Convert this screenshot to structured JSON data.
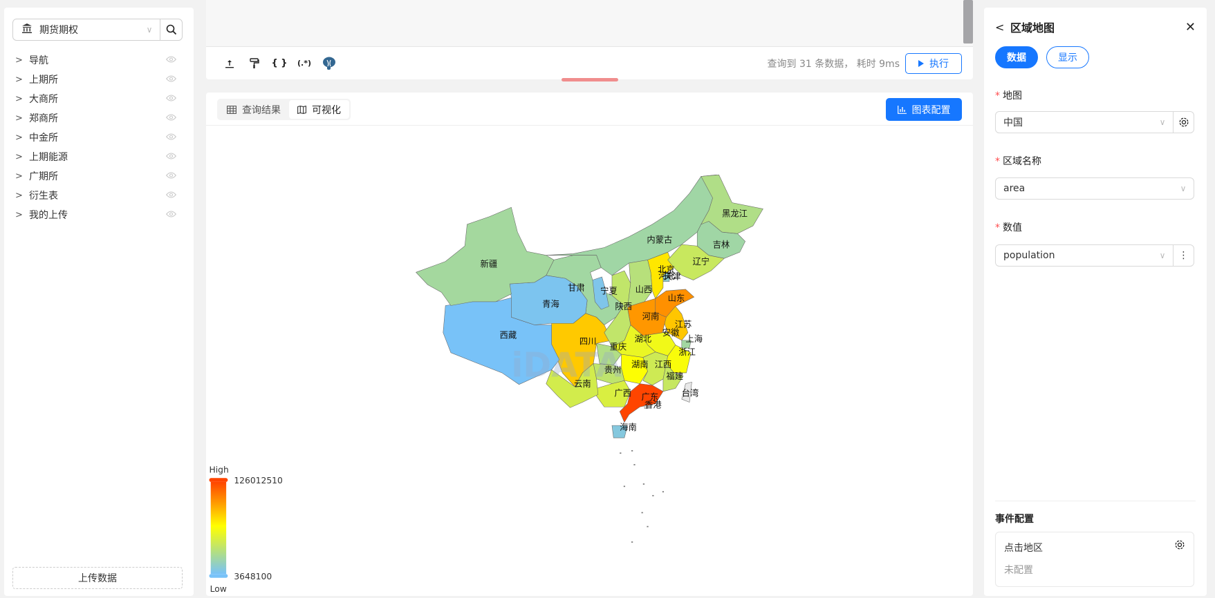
{
  "sidebar": {
    "selector": {
      "value": "期货期权",
      "icon": "bank-icon"
    },
    "items": [
      {
        "label": "导航"
      },
      {
        "label": "上期所"
      },
      {
        "label": "大商所"
      },
      {
        "label": "郑商所"
      },
      {
        "label": "中金所"
      },
      {
        "label": "上期能源"
      },
      {
        "label": "广期所"
      },
      {
        "label": "衍生表"
      },
      {
        "label": "我的上传"
      }
    ],
    "upload_label": "上传数据"
  },
  "toolbar": {
    "icons": [
      "upload-icon",
      "paint-roller-icon",
      "braces-icon",
      "regex-icon",
      "postgresql-icon"
    ],
    "braces": "{ }",
    "regex": "(.*)",
    "status": "查询到 31 条数据， 耗时 9ms",
    "run_label": "执行"
  },
  "result": {
    "tabs": [
      {
        "label": "查询结果",
        "active": false
      },
      {
        "label": "可视化",
        "active": true
      }
    ],
    "config_label": "图表配置",
    "watermark": "iDATA"
  },
  "right_panel": {
    "title": "区域地图",
    "pills": [
      {
        "label": "数据",
        "active": true
      },
      {
        "label": "显示",
        "active": false
      }
    ],
    "fields": [
      {
        "label": "地图",
        "value": "中国"
      },
      {
        "label": "区域名称",
        "value": "area"
      },
      {
        "label": "数值",
        "value": "population"
      }
    ],
    "event_title": "事件配置",
    "event": {
      "name": "点击地区",
      "status": "未配置"
    }
  },
  "colors": {
    "accent": "#1677ff",
    "scale": [
      "#78c2f8",
      "#a8da95",
      "#ffff00",
      "#ff9f00",
      "#ff4500"
    ],
    "no_data": "#e8e8e8"
  },
  "chart_data": {
    "type": "map",
    "map": "中国",
    "legend": {
      "high_label": "High",
      "low_label": "Low",
      "max": 126012510,
      "min": 3648100,
      "placement": "bottom-left"
    },
    "regions": [
      {
        "name": "北京",
        "value": 21893095
      },
      {
        "name": "天津",
        "value": 13866009
      },
      {
        "name": "河北",
        "value": 74610235
      },
      {
        "name": "山西",
        "value": 34915616
      },
      {
        "name": "内蒙古",
        "value": 24049155
      },
      {
        "name": "辽宁",
        "value": 42591407
      },
      {
        "name": "吉林",
        "value": 24073453
      },
      {
        "name": "黑龙江",
        "value": 31850088
      },
      {
        "name": "上海",
        "value": 24870895
      },
      {
        "name": "江苏",
        "value": 84748016
      },
      {
        "name": "浙江",
        "value": 64567588
      },
      {
        "name": "安徽",
        "value": 61027171
      },
      {
        "name": "福建",
        "value": 41540086
      },
      {
        "name": "江西",
        "value": 45188635
      },
      {
        "name": "山东",
        "value": 101527453
      },
      {
        "name": "河南",
        "value": 99365519
      },
      {
        "name": "湖北",
        "value": 57752557
      },
      {
        "name": "湖南",
        "value": 66444864
      },
      {
        "name": "广东",
        "value": 126012510
      },
      {
        "name": "广西",
        "value": 50126804
      },
      {
        "name": "海南",
        "value": 10081232
      },
      {
        "name": "重庆",
        "value": 32054159
      },
      {
        "name": "四川",
        "value": 83674866
      },
      {
        "name": "贵州",
        "value": 38562148
      },
      {
        "name": "云南",
        "value": 47209277
      },
      {
        "name": "西藏",
        "value": 3648100
      },
      {
        "name": "陕西",
        "value": 39528999
      },
      {
        "name": "甘肃",
        "value": 25019831
      },
      {
        "name": "青海",
        "value": 5923957
      },
      {
        "name": "宁夏",
        "value": 7202654
      },
      {
        "name": "新疆",
        "value": 25852345
      },
      {
        "name": "台湾",
        "value": null
      },
      {
        "name": "香港",
        "value": null
      }
    ]
  }
}
